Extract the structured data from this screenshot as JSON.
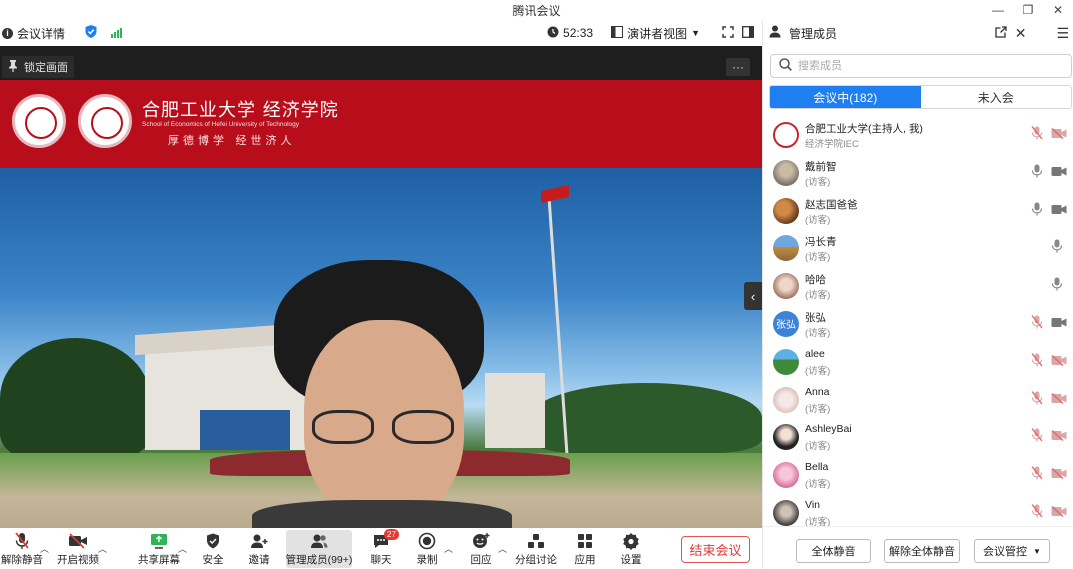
{
  "window": {
    "title": "腾讯会议",
    "controls": [
      "—",
      "❐",
      "✕"
    ]
  },
  "toolbar": {
    "meeting_details": "会议详情",
    "timer": "52:33",
    "view_mode": "演讲者视图"
  },
  "video": {
    "lock_label": "锁定画面",
    "more": "···",
    "banner": {
      "name": "合肥工业大学 经济学院",
      "english": "School of Economics of Hefei University of Technology",
      "motto": "厚德博学 经世济人"
    }
  },
  "bottombar": {
    "unmute": "解除静音",
    "start_video": "开启视频",
    "share_screen": "共享屏幕",
    "security": "安全",
    "invite": "邀请",
    "manage_members": "管理成员(99+)",
    "chat": "聊天",
    "chat_badge": "27",
    "record": "录制",
    "reactions": "回应",
    "breakout": "分组讨论",
    "apps": "应用",
    "settings": "设置",
    "end_meeting": "结束会议"
  },
  "panel": {
    "title": "管理成员",
    "search_placeholder": "搜索成员",
    "tab_in_meeting": "会议中(182)",
    "tab_not_joined": "未入会",
    "members": [
      {
        "name": "合肥工业大学(主持人, 我)",
        "role": "经济学院IEC",
        "avatar": "logo",
        "mic": "muted",
        "cam": "off"
      },
      {
        "name": "戴前智",
        "role": "(访客)",
        "avatar": "photo-gray",
        "mic": "on",
        "cam": "on"
      },
      {
        "name": "赵志国爸爸",
        "role": "(访客)",
        "avatar": "photo-brown",
        "mic": "on",
        "cam": "on"
      },
      {
        "name": "冯长青",
        "role": "(访客)",
        "avatar": "photo-landscape",
        "mic": "on",
        "cam": "none"
      },
      {
        "name": "哈哈",
        "role": "(访客)",
        "avatar": "photo-girl",
        "mic": "on",
        "cam": "none"
      },
      {
        "name": "张弘",
        "role": "(访客)",
        "avatar": "text",
        "avatar_text": "张弘",
        "mic": "muted",
        "cam": "on"
      },
      {
        "name": "alee",
        "role": "(访客)",
        "avatar": "photo-green",
        "mic": "muted",
        "cam": "off"
      },
      {
        "name": "Anna",
        "role": "(访客)",
        "avatar": "photo-flower",
        "mic": "muted",
        "cam": "off"
      },
      {
        "name": "AshleyBai",
        "role": "(访客)",
        "avatar": "photo-cartoon",
        "mic": "muted",
        "cam": "off"
      },
      {
        "name": "Bella",
        "role": "(访客)",
        "avatar": "photo-pink",
        "mic": "muted",
        "cam": "off"
      },
      {
        "name": "Vin",
        "role": "(访客)",
        "avatar": "photo-dark",
        "mic": "muted",
        "cam": "off"
      }
    ],
    "mute_all": "全体静音",
    "unmute_all": "解除全体静音",
    "meeting_control": "会议管控"
  },
  "colors": {
    "accent": "#1f7ff0",
    "danger": "#e03a3a",
    "banner": "#b80e1c",
    "muted_icon": "#e88"
  }
}
